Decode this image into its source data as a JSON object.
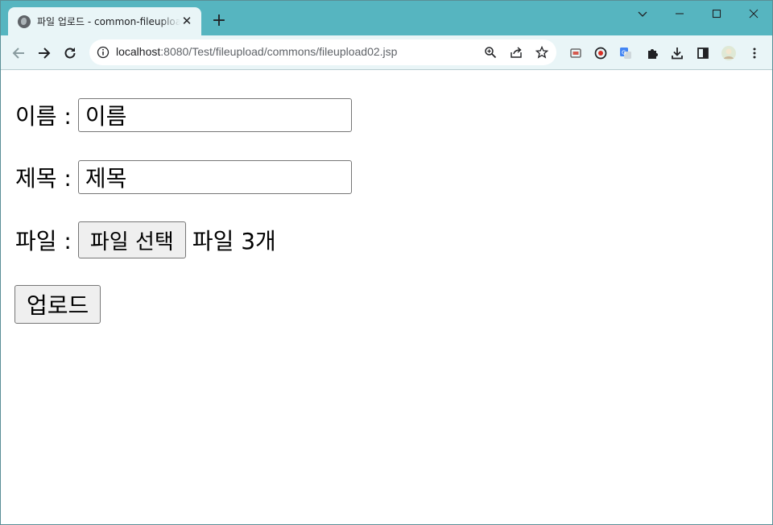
{
  "browser": {
    "tab": {
      "title": "파일 업로드 - common-fileupload",
      "close_glyph": "✕"
    },
    "new_tab_glyph": "+",
    "window_controls": {
      "dropdown": "chevron-down-icon",
      "minimize": "minimize-icon",
      "maximize": "maximize-icon",
      "close": "close-icon"
    },
    "address": {
      "host": "localhost",
      "rest": ":8080/Test/fileupload/commons/fileupload02.jsp"
    },
    "accent_color": "#56b5c0",
    "toolbar_color": "#e9f5f7"
  },
  "form": {
    "name": {
      "label": "이름 :",
      "value": "이름"
    },
    "title": {
      "label": "제목 :",
      "value": "제목"
    },
    "file": {
      "label": "파일 :",
      "button": "파일 선택",
      "status": "파일 3개"
    },
    "submit": "업로드"
  }
}
